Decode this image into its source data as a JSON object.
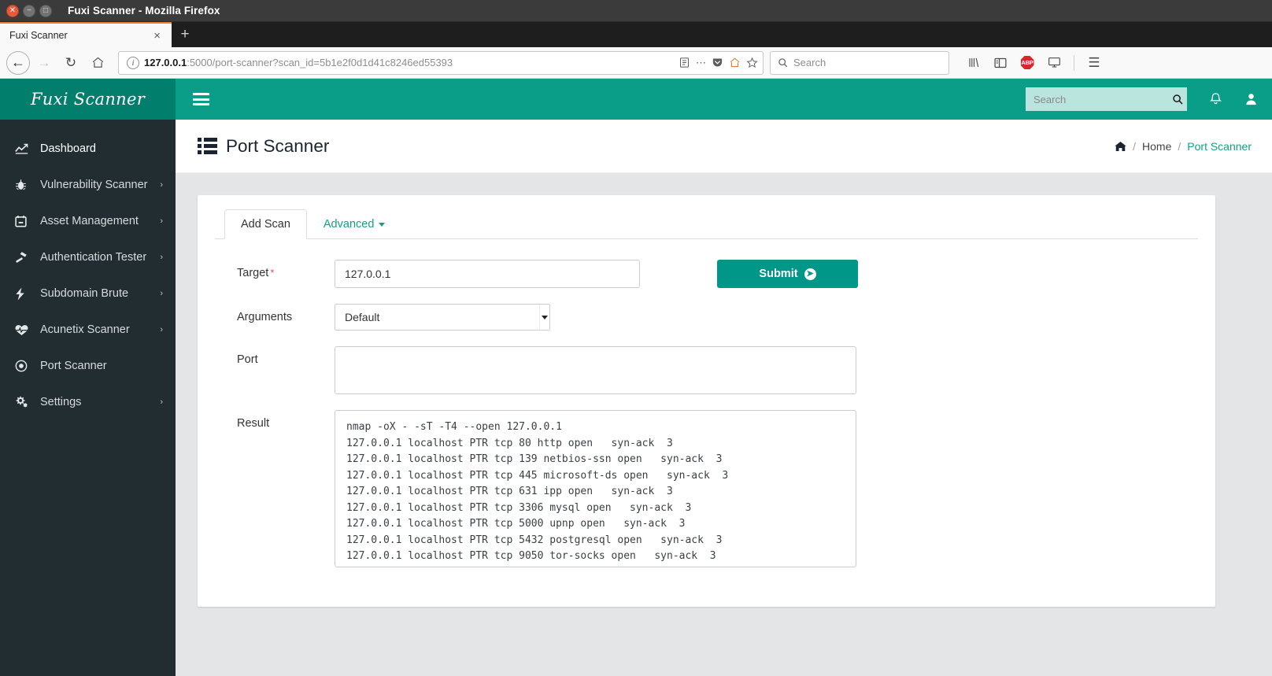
{
  "browser": {
    "window_title": "Fuxi Scanner - Mozilla Firefox",
    "tab_title": "Fuxi Scanner",
    "tab_close_glyph": "×",
    "new_tab_glyph": "+",
    "back_glyph": "←",
    "forward_glyph": "→",
    "reload_glyph": "↻",
    "home_glyph": "⌂",
    "url_host": "127.0.0.1",
    "url_rest": ":5000/port-scanner?scan_id=5b1e2f0d1d41c8246ed55393",
    "search_placeholder": "Search",
    "abp_label": "ABP",
    "menu_glyph": "☰"
  },
  "app": {
    "brand": "Fuxi Scanner",
    "search_placeholder": "Search",
    "page_title": "Port Scanner"
  },
  "breadcrumb": {
    "home": "Home",
    "separator": "/",
    "current": "Port Scanner"
  },
  "sidebar": {
    "items": [
      {
        "label": "Dashboard",
        "icon": "chart-line-icon",
        "arrow": "",
        "active": true
      },
      {
        "label": "Vulnerability Scanner",
        "icon": "bug-icon",
        "arrow": "›",
        "active": false
      },
      {
        "label": "Asset Management",
        "icon": "calendar-icon",
        "arrow": "›",
        "active": false
      },
      {
        "label": "Authentication Tester",
        "icon": "hammer-icon",
        "arrow": "›",
        "active": false
      },
      {
        "label": "Subdomain Brute",
        "icon": "bolt-icon",
        "arrow": "›",
        "active": false
      },
      {
        "label": "Acunetix Scanner",
        "icon": "heartbeat-icon",
        "arrow": "›",
        "active": false
      },
      {
        "label": "Port Scanner",
        "icon": "dot-circle-icon",
        "arrow": "",
        "active": false
      },
      {
        "label": "Settings",
        "icon": "gears-icon",
        "arrow": "›",
        "active": false
      }
    ]
  },
  "tabs": [
    {
      "label": "Add Scan",
      "active": true,
      "has_caret": false
    },
    {
      "label": "Advanced",
      "active": false,
      "has_caret": true
    }
  ],
  "form": {
    "target_label": "Target",
    "target_required": "*",
    "target_value": "127.0.0.1",
    "arguments_label": "Arguments",
    "arguments_value": "Default",
    "arguments_options": [
      "Default"
    ],
    "port_label": "Port",
    "port_value": "",
    "result_label": "Result",
    "submit_label": "Submit",
    "submit_icon_glyph": "➤",
    "result_value": "nmap -oX - -sT -T4 --open 127.0.0.1\n127.0.0.1 localhost PTR tcp 80 http open   syn-ack  3\n127.0.0.1 localhost PTR tcp 139 netbios-ssn open   syn-ack  3\n127.0.0.1 localhost PTR tcp 445 microsoft-ds open   syn-ack  3\n127.0.0.1 localhost PTR tcp 631 ipp open   syn-ack  3\n127.0.0.1 localhost PTR tcp 3306 mysql open   syn-ack  3\n127.0.0.1 localhost PTR tcp 5000 upnp open   syn-ack  3\n127.0.0.1 localhost PTR tcp 5432 postgresql open   syn-ack  3\n127.0.0.1 localhost PTR tcp 9050 tor-socks open   syn-ack  3"
  },
  "colors": {
    "navbar_teal": "#0a9d88",
    "brand_teal": "#017f6c",
    "sidebar_dark": "#222d32",
    "accent_link": "#14a085",
    "submit_green": "#009688",
    "page_bg": "#e4e5e6",
    "required_red": "#e04f4f"
  }
}
